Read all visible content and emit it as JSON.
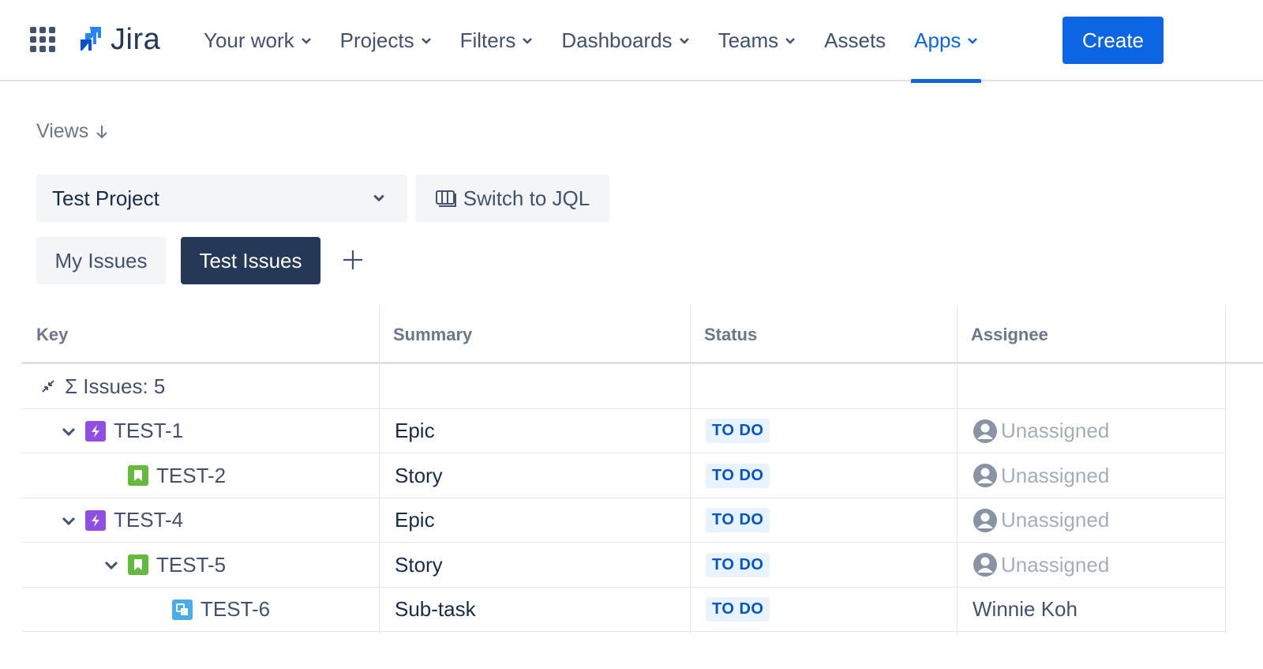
{
  "nav": {
    "logo": "Jira",
    "items": [
      {
        "label": "Your work",
        "dropdown": true
      },
      {
        "label": "Projects",
        "dropdown": true
      },
      {
        "label": "Filters",
        "dropdown": true
      },
      {
        "label": "Dashboards",
        "dropdown": true
      },
      {
        "label": "Teams",
        "dropdown": true
      },
      {
        "label": "Assets",
        "dropdown": false
      },
      {
        "label": "Apps",
        "dropdown": true,
        "active": true
      }
    ],
    "create_label": "Create"
  },
  "views": {
    "label": "Views"
  },
  "project_select": {
    "value": "Test Project"
  },
  "jql_button": {
    "label": "Switch to JQL"
  },
  "tabs": [
    {
      "label": "My Issues",
      "selected": false
    },
    {
      "label": "Test Issues",
      "selected": true
    }
  ],
  "table": {
    "columns": [
      "Key",
      "Summary",
      "Status",
      "Assignee"
    ],
    "summary_row": {
      "label": "Σ Issues: 5"
    },
    "rows": [
      {
        "key": "TEST-1",
        "summary": "Epic",
        "status": "TO DO",
        "assignee": "Unassigned",
        "type": "epic-icon",
        "level": 0,
        "expander": true
      },
      {
        "key": "TEST-2",
        "summary": "Story",
        "status": "TO DO",
        "assignee": "Unassigned",
        "type": "story-icon",
        "level": 1,
        "expander": false
      },
      {
        "key": "TEST-4",
        "summary": "Epic",
        "status": "TO DO",
        "assignee": "Unassigned",
        "type": "epic-icon",
        "level": 0,
        "expander": true
      },
      {
        "key": "TEST-5",
        "summary": "Story",
        "status": "TO DO",
        "assignee": "Unassigned",
        "type": "story-icon",
        "level": 1,
        "expander": true
      },
      {
        "key": "TEST-6",
        "summary": "Sub-task",
        "status": "TO DO",
        "assignee": "Winnie Koh",
        "type": "subtask-icon",
        "level": 2,
        "expander": false
      }
    ]
  },
  "colors": {
    "brand": "#0C66E4",
    "epic": "#904EE2",
    "story": "#63BA3C",
    "subtask": "#4BADE8",
    "lozenge_bg": "#E9F2FF",
    "lozenge_text": "#0055CC"
  }
}
